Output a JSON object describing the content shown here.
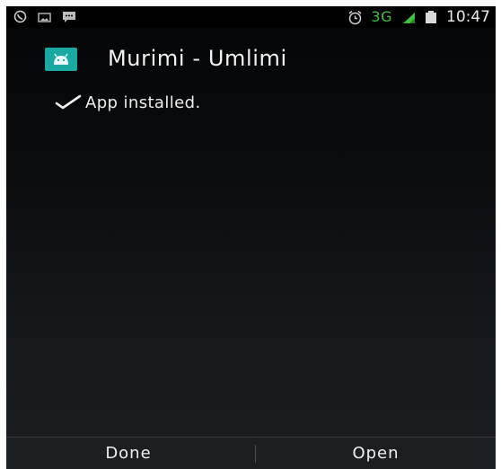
{
  "status_bar": {
    "left_icons": [
      "whatsapp-icon",
      "image-icon",
      "chat-icon"
    ],
    "alarm_icon": "alarm-icon",
    "network_type": "3G",
    "signal_icon": "signal-icon",
    "battery_icon": "battery-icon",
    "time": "10:47",
    "network_color": "#3ec23e"
  },
  "header": {
    "app_icon": "android-icon",
    "app_name": "Murimi - Umlimi",
    "icon_color": "#19a9a2"
  },
  "install_status": {
    "icon": "checkmark-icon",
    "message": "App installed."
  },
  "actions": {
    "done_label": "Done",
    "open_label": "Open"
  }
}
